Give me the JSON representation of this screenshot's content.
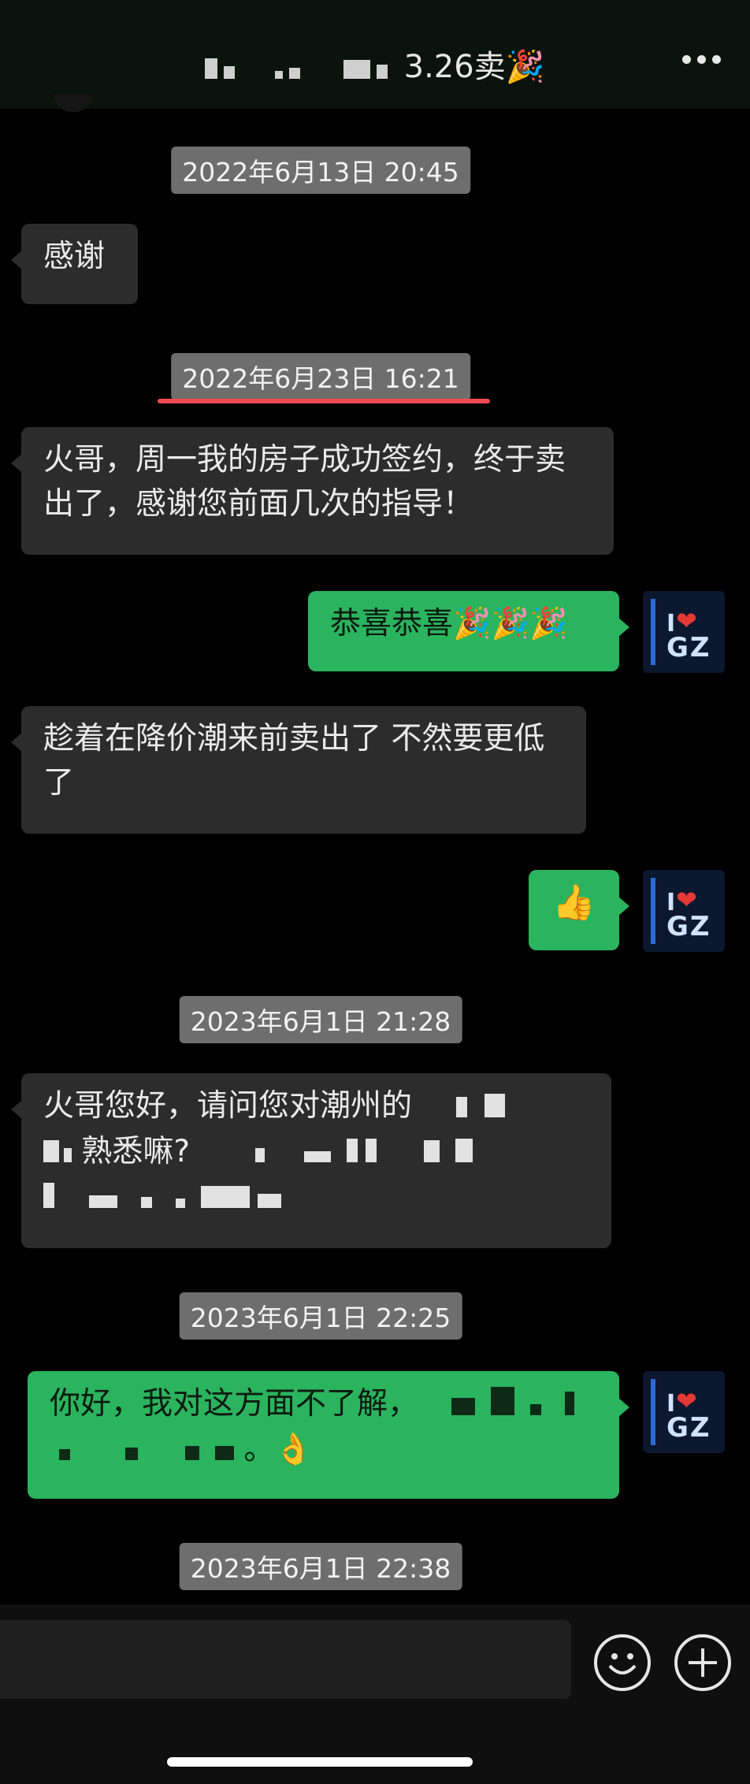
{
  "header": {
    "title_suffix": "3.26卖",
    "emoji": "🎉"
  },
  "timestamps": {
    "t1": "2022年6月13日 20:45",
    "t2": "2022年6月23日 16:21",
    "t3": "2023年6月1日 21:28",
    "t4": "2023年6月1日 22:25",
    "t5": "2023年6月1日 22:38"
  },
  "messages": {
    "m1": "感谢",
    "m2": "火哥，周一我的房子成功签约，终于卖出了，感谢您前面几次的指导！",
    "m3": "恭喜恭喜🎉🎉🎉",
    "m4": "趁着在降价潮来前卖出了 不然要更低了",
    "m5": "👍",
    "m6_visible": "火哥您好，请问您对潮州的",
    "m6_tail": "熟悉嘛?",
    "m7_visible": "你好，我对这方面不了解，",
    "m7_tail": "。👌"
  },
  "avatar": {
    "text": "GZ",
    "heart": "❤"
  },
  "colors": {
    "outgoing": "#2bb45e",
    "incoming": "#2c2c2c",
    "timestamp": "#6e6e6e",
    "highlight": "#f24b4f"
  }
}
